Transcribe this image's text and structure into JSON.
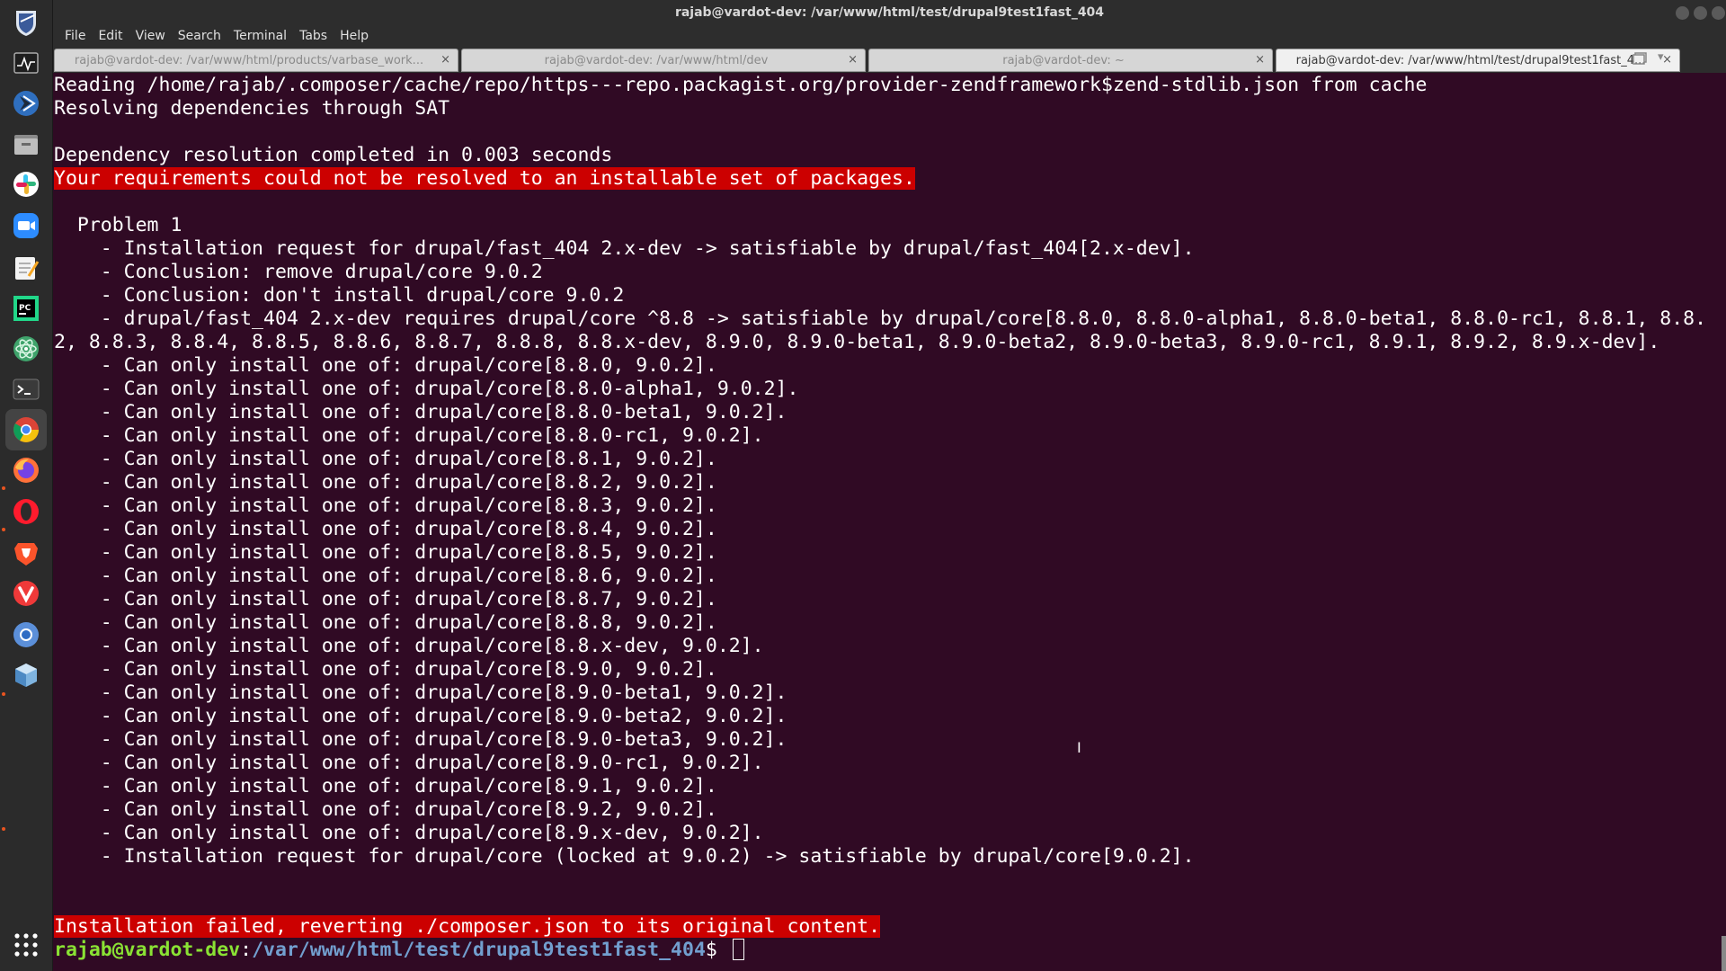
{
  "window": {
    "title": "rajab@vardot-dev: /var/www/html/test/drupal9test1fast_404"
  },
  "menu": [
    "File",
    "Edit",
    "View",
    "Search",
    "Terminal",
    "Tabs",
    "Help"
  ],
  "tabs": [
    {
      "label": "rajab@vardot-dev: /var/www/html/products/varbase_work...",
      "close": "×"
    },
    {
      "label": "rajab@vardot-dev: /var/www/html/dev",
      "close": "×"
    },
    {
      "label": "rajab@vardot-dev: ~",
      "close": "×"
    },
    {
      "label": "rajab@vardot-dev: /var/www/html/test/drupal9test1fast_4...",
      "close": "×"
    }
  ],
  "dock": [
    {
      "name": "security-app-icon"
    },
    {
      "name": "system-monitor-icon"
    },
    {
      "name": "remote-desktop-icon"
    },
    {
      "name": "file-manager-icon"
    },
    {
      "name": "slack-icon"
    },
    {
      "name": "zoom-icon"
    },
    {
      "name": "text-editor-icon"
    },
    {
      "name": "pycharm-icon"
    },
    {
      "name": "atom-icon"
    },
    {
      "name": "terminal-icon"
    },
    {
      "name": "chrome-icon"
    },
    {
      "name": "firefox-icon"
    },
    {
      "name": "opera-icon"
    },
    {
      "name": "brave-icon"
    },
    {
      "name": "vivaldi-icon"
    },
    {
      "name": "chromium-icon"
    },
    {
      "name": "virtualbox-icon"
    }
  ],
  "terminal": {
    "lines": [
      {
        "text": "Reading /home/rajab/.composer/cache/repo/https---repo.packagist.org/provider-zendframework$zend-stdlib.json from cache"
      },
      {
        "text": "Resolving dependencies through SAT"
      },
      {
        "text": ""
      },
      {
        "text": "Dependency resolution completed in 0.003 seconds"
      },
      {
        "text": "Your requirements could not be resolved to an installable set of packages.",
        "error": true
      },
      {
        "text": ""
      },
      {
        "text": "  Problem 1"
      },
      {
        "text": "    - Installation request for drupal/fast_404 2.x-dev -> satisfiable by drupal/fast_404[2.x-dev]."
      },
      {
        "text": "    - Conclusion: remove drupal/core 9.0.2"
      },
      {
        "text": "    - Conclusion: don't install drupal/core 9.0.2"
      },
      {
        "text": "    - drupal/fast_404 2.x-dev requires drupal/core ^8.8 -> satisfiable by drupal/core[8.8.0, 8.8.0-alpha1, 8.8.0-beta1, 8.8.0-rc1, 8.8.1, 8.8."
      },
      {
        "text": "2, 8.8.3, 8.8.4, 8.8.5, 8.8.6, 8.8.7, 8.8.8, 8.8.x-dev, 8.9.0, 8.9.0-beta1, 8.9.0-beta2, 8.9.0-beta3, 8.9.0-rc1, 8.9.1, 8.9.2, 8.9.x-dev]."
      },
      {
        "text": "    - Can only install one of: drupal/core[8.8.0, 9.0.2]."
      },
      {
        "text": "    - Can only install one of: drupal/core[8.8.0-alpha1, 9.0.2]."
      },
      {
        "text": "    - Can only install one of: drupal/core[8.8.0-beta1, 9.0.2]."
      },
      {
        "text": "    - Can only install one of: drupal/core[8.8.0-rc1, 9.0.2]."
      },
      {
        "text": "    - Can only install one of: drupal/core[8.8.1, 9.0.2]."
      },
      {
        "text": "    - Can only install one of: drupal/core[8.8.2, 9.0.2]."
      },
      {
        "text": "    - Can only install one of: drupal/core[8.8.3, 9.0.2]."
      },
      {
        "text": "    - Can only install one of: drupal/core[8.8.4, 9.0.2]."
      },
      {
        "text": "    - Can only install one of: drupal/core[8.8.5, 9.0.2]."
      },
      {
        "text": "    - Can only install one of: drupal/core[8.8.6, 9.0.2]."
      },
      {
        "text": "    - Can only install one of: drupal/core[8.8.7, 9.0.2]."
      },
      {
        "text": "    - Can only install one of: drupal/core[8.8.8, 9.0.2]."
      },
      {
        "text": "    - Can only install one of: drupal/core[8.8.x-dev, 9.0.2]."
      },
      {
        "text": "    - Can only install one of: drupal/core[8.9.0, 9.0.2]."
      },
      {
        "text": "    - Can only install one of: drupal/core[8.9.0-beta1, 9.0.2]."
      },
      {
        "text": "    - Can only install one of: drupal/core[8.9.0-beta2, 9.0.2]."
      },
      {
        "text": "    - Can only install one of: drupal/core[8.9.0-beta3, 9.0.2]."
      },
      {
        "text": "    - Can only install one of: drupal/core[8.9.0-rc1, 9.0.2]."
      },
      {
        "text": "    - Can only install one of: drupal/core[8.9.1, 9.0.2]."
      },
      {
        "text": "    - Can only install one of: drupal/core[8.9.2, 9.0.2]."
      },
      {
        "text": "    - Can only install one of: drupal/core[8.9.x-dev, 9.0.2]."
      },
      {
        "text": "    - Installation request for drupal/core (locked at 9.0.2) -> satisfiable by drupal/core[9.0.2]."
      },
      {
        "text": ""
      },
      {
        "text": ""
      },
      {
        "text": "Installation failed, reverting ./composer.json to its original content.",
        "error": true
      }
    ],
    "prompt": {
      "user": "rajab@vardot-dev",
      "separator": ":",
      "path": "/var/www/html/test/drupal9test1fast_404",
      "symbol": "$ "
    },
    "ibeam": "I"
  },
  "colors": {
    "terminal_bg": "#300a24",
    "error_bg": "#cc0000",
    "prompt_user": "#8ae234",
    "prompt_path": "#729fcf"
  }
}
